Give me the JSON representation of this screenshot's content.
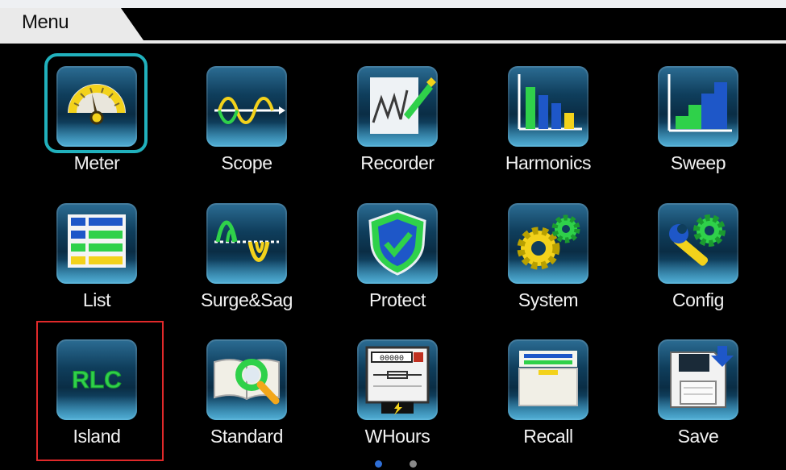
{
  "header": {
    "title": "Menu"
  },
  "menu_items": [
    {
      "label": "Meter",
      "icon": "meter-icon"
    },
    {
      "label": "Scope",
      "icon": "scope-icon"
    },
    {
      "label": "Recorder",
      "icon": "recorder-icon"
    },
    {
      "label": "Harmonics",
      "icon": "harmonics-icon"
    },
    {
      "label": "Sweep",
      "icon": "sweep-icon"
    },
    {
      "label": "List",
      "icon": "list-icon"
    },
    {
      "label": "Surge&Sag",
      "icon": "surge-sag-icon"
    },
    {
      "label": "Protect",
      "icon": "protect-icon"
    },
    {
      "label": "System",
      "icon": "system-gear-icon"
    },
    {
      "label": "Config",
      "icon": "config-wrench-icon"
    },
    {
      "label": "Island",
      "icon": "island-rlc-icon",
      "icon_text": "RLC"
    },
    {
      "label": "Standard",
      "icon": "standard-book-icon"
    },
    {
      "label": "WHours",
      "icon": "watt-hour-meter-icon",
      "icon_text": "00000"
    },
    {
      "label": "Recall",
      "icon": "recall-folder-icon"
    },
    {
      "label": "Save",
      "icon": "save-floppy-icon"
    }
  ],
  "selected_item": "Meter",
  "highlighted_item": "Island",
  "pagination": {
    "page_count": 2,
    "current_page": 1
  },
  "colors": {
    "background": "#000000",
    "selection_ring": "#21b1bd",
    "highlight_box": "#e0292a",
    "active_dot": "#2f6fd6",
    "inactive_dot": "#8a8a8a"
  }
}
